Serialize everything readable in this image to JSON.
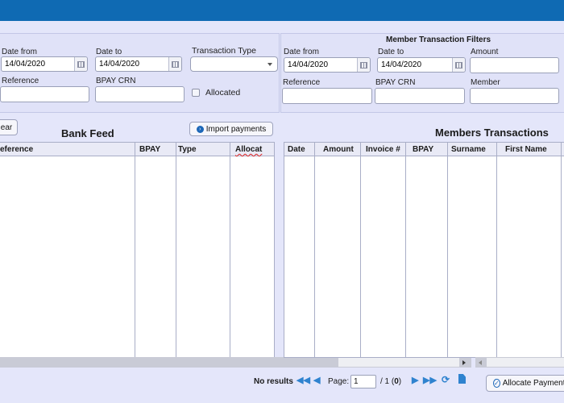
{
  "bank_filters": {
    "date_from_label": "Date from",
    "date_from_value": "14/04/2020",
    "date_to_label": "Date to",
    "date_to_value": "14/04/2020",
    "transaction_type_label": "Transaction Type",
    "transaction_type_value": "",
    "reference_label": "Reference",
    "reference_value": "",
    "bpay_crn_label": "BPAY CRN",
    "bpay_crn_value": "",
    "allocated_label": "Allocated"
  },
  "member_filters": {
    "title": "Member Transaction Filters",
    "date_from_label": "Date from",
    "date_from_value": "14/04/2020",
    "date_to_label": "Date to",
    "date_to_value": "14/04/2020",
    "amount_label": "Amount",
    "amount_value": "",
    "reference_label": "Reference",
    "reference_value": "",
    "bpay_crn_label": "BPAY CRN",
    "bpay_crn_value": "",
    "member_label": "Member",
    "member_value": ""
  },
  "bank_feed": {
    "clear_label": "ear",
    "title": "Bank Feed",
    "import_label": "Import payments",
    "columns": [
      "eference",
      "BPAY",
      "Type",
      "Allocat"
    ]
  },
  "members_transactions": {
    "title": "Members Transactions",
    "columns": [
      "Date",
      "Amount",
      "Invoice #",
      "BPAY",
      "Surname",
      "First Name"
    ]
  },
  "pager": {
    "no_results": "No results",
    "page_label": "Page:",
    "page_value": "1",
    "of_text": "/ 1 (",
    "count": "0",
    "close_paren": ")"
  },
  "allocate_label": "Allocate Payments",
  "colors": {
    "topbar": "#0f6ab3",
    "background": "#e4e6fa",
    "accent": "#2f83cf"
  }
}
